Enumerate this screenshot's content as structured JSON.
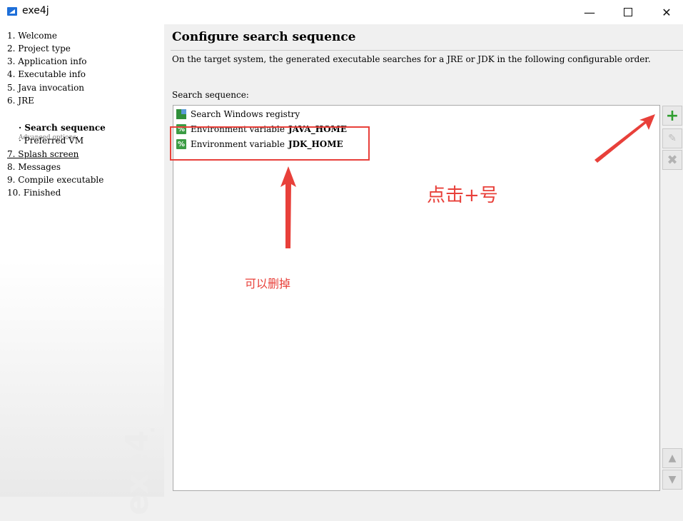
{
  "window": {
    "title": "exe4j",
    "minimize_glyph": "—",
    "close_glyph": "✕"
  },
  "sidebar": {
    "steps": [
      {
        "label": "1. Welcome"
      },
      {
        "label": "2. Project type"
      },
      {
        "label": "3. Application info"
      },
      {
        "label": "4. Executable info"
      },
      {
        "label": "5. Java invocation"
      },
      {
        "label": "6. JRE"
      },
      {
        "label": "· Search sequence"
      },
      {
        "label": "· Preferred VM"
      },
      {
        "label": "7. Splash screen"
      },
      {
        "label": "8. Messages"
      },
      {
        "label": "9. Compile executable"
      },
      {
        "label": "10. Finished"
      }
    ],
    "advanced_label": "Advanced options:",
    "watermark": "exe4j"
  },
  "main": {
    "title": "Configure search sequence",
    "description": "On the target system, the generated executable searches for a JRE or JDK in the following configurable order.",
    "sequence_label": "Search sequence:",
    "items": [
      {
        "text": "Search Windows registry",
        "name": "",
        "icon": "registry-icon"
      },
      {
        "text": "Environment variable",
        "name": "JAVA_HOME",
        "icon": "env-var-icon"
      },
      {
        "text": "Environment variable",
        "name": "JDK_HOME",
        "icon": "env-var-icon"
      }
    ],
    "buttons": {
      "add": "+",
      "edit": "✎",
      "delete": "✖",
      "up": "▲",
      "down": "▼"
    }
  },
  "annotations": {
    "click_plus": "点击+号",
    "can_delete": "可以删掉",
    "color": "#e8403a"
  }
}
